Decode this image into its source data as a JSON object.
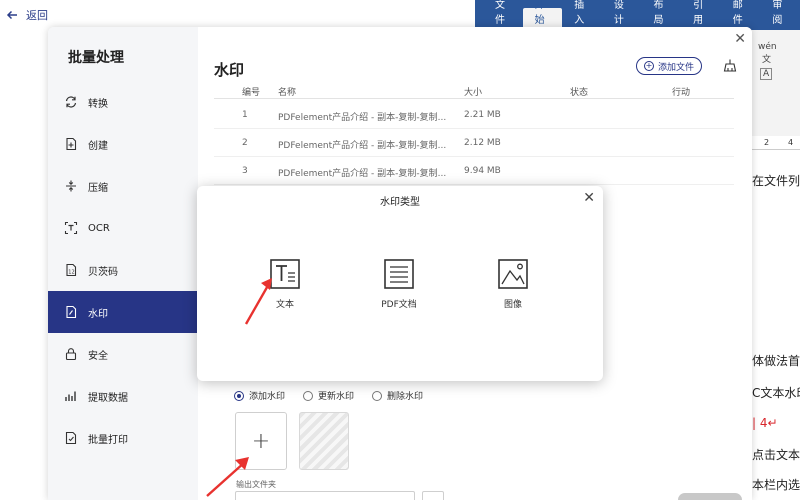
{
  "topbar": {
    "back_label": "返回"
  },
  "ribbon": {
    "tabs": [
      "文件",
      "开始",
      "插入",
      "设计",
      "布局",
      "引用",
      "邮件",
      "审阅"
    ],
    "active": "开始"
  },
  "doc": {
    "ruler": [
      "2",
      "4"
    ],
    "mini_icons": {
      "wen": "wén",
      "wen2": "文",
      "a": "A"
    },
    "lines": [
      {
        "text": "在文件列",
        "red": false
      },
      {
        "text": "体做法首",
        "red": false
      },
      {
        "text": "C文本水印",
        "red": false
      },
      {
        "text": "| 4↵",
        "red": true
      },
      {
        "text": "点击文本",
        "red": false
      },
      {
        "text": "本栏内选",
        "red": false
      }
    ]
  },
  "sidebar": {
    "title": "批量处理",
    "items": [
      {
        "label": "转换",
        "icon": "convert-icon"
      },
      {
        "label": "创建",
        "icon": "create-icon"
      },
      {
        "label": "压缩",
        "icon": "compress-icon"
      },
      {
        "label": "OCR",
        "icon": "ocr-icon"
      },
      {
        "label": "贝茨码",
        "icon": "bates-icon"
      },
      {
        "label": "水印",
        "icon": "watermark-icon",
        "active": true
      },
      {
        "label": "安全",
        "icon": "lock-icon"
      },
      {
        "label": "提取数据",
        "icon": "extract-icon"
      },
      {
        "label": "批量打印",
        "icon": "print-icon"
      }
    ]
  },
  "main": {
    "title": "水印",
    "add_file_label": "添加文件",
    "table": {
      "headers": {
        "num": "编号",
        "name": "名称",
        "size": "大小",
        "status": "状态",
        "action": "行动"
      },
      "rows": [
        {
          "num": "1",
          "name": "PDFelement产品介绍 - 副本-复制-复制...",
          "size": "2.21 MB"
        },
        {
          "num": "2",
          "name": "PDFelement产品介绍 - 副本-复制-复制...",
          "size": "2.12 MB"
        },
        {
          "num": "3",
          "name": "PDFelement产品介绍 - 副本-复制-复制...",
          "size": "9.94 MB"
        }
      ]
    },
    "radios": [
      {
        "label": "添加水印",
        "selected": true
      },
      {
        "label": "更新水印",
        "selected": false
      },
      {
        "label": "删除水印",
        "selected": false
      }
    ],
    "add_symbol": "+",
    "output_label": "输出文件夹"
  },
  "modal": {
    "title": "水印类型",
    "options": [
      {
        "label": "文本",
        "icon": "text-icon"
      },
      {
        "label": "PDF文档",
        "icon": "pdf-document-icon"
      },
      {
        "label": "图像",
        "icon": "image-icon"
      }
    ]
  },
  "colors": {
    "accent": "#273586",
    "annotation_arrow": "#e8322f",
    "ribbon": "#2b579a"
  }
}
